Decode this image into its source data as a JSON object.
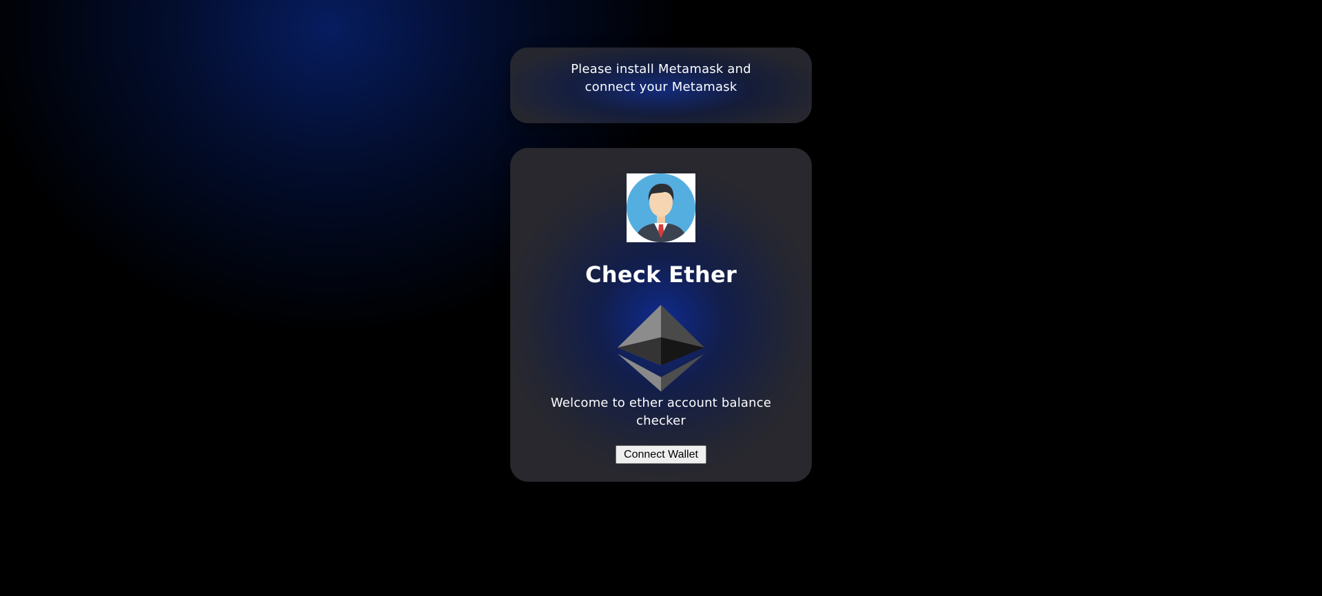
{
  "notice": {
    "message": "Please install Metamask and connect your Metamask"
  },
  "main_card": {
    "avatar_icon": "user-avatar-icon",
    "title": "Check Ether",
    "logo_icon": "ethereum-logo-icon",
    "welcome_text": "Welcome to ether account balance checker",
    "connect_button_label": "Connect Wallet"
  },
  "colors": {
    "background": "#000000",
    "glow": "#0a2a8c",
    "card_text": "#ffffff",
    "button_bg": "#efefef"
  }
}
